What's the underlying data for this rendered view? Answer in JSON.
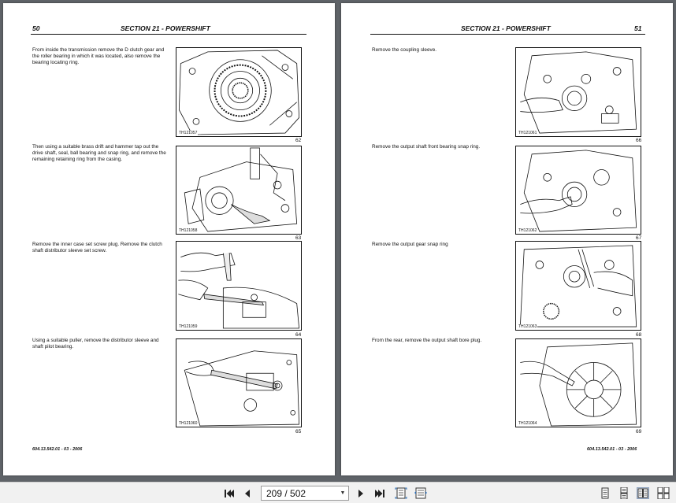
{
  "viewer": {
    "current_page": "209",
    "page_separator": "/",
    "total_pages": "502",
    "page_display": "209 / 502"
  },
  "left_page": {
    "page_number": "50",
    "section_title": "SECTION 21 -  POWERSHIFT",
    "footer": "604.13.542.01 - 03 - 2006",
    "steps": [
      {
        "text": "From inside the transmission remove the D clutch gear and the roller bearing in which it was located, also remove the bearing locating ring.",
        "code": "TH121057",
        "figure": "62"
      },
      {
        "text": "Then using a suitable brass drift and hammer tap out the drive shaft, seal, ball bearing and snap ring, and remove the remaining retaining ring from the casing.",
        "code": "TH121058",
        "figure": "63"
      },
      {
        "text": "Remove the inner case set screw plug. Remove the clutch shaft distributor sleeve set screw.",
        "code": "TH121059",
        "figure": "64"
      },
      {
        "text": "Using a suitable puller, remove the distributor sleeve and shaft pilot bearing.",
        "code": "TH121060",
        "figure": "65"
      }
    ]
  },
  "right_page": {
    "page_number": "51",
    "section_title": "SECTION 21 -  POWERSHIFT",
    "footer": "604.13.542.01 - 03 - 2006",
    "steps": [
      {
        "text": "Remove the coupling sleeve.",
        "code": "TH121061",
        "figure": "66"
      },
      {
        "text": "Remove the output shaft front bearing snap ring.",
        "code": "TH121062",
        "figure": "67"
      },
      {
        "text": "Remove the output gear snap ring",
        "code": "TH121063",
        "figure": "68"
      },
      {
        "text": "From the rear, remove the output shaft bore plug.",
        "code": "TH121064",
        "figure": "69"
      }
    ]
  },
  "toolbar": {
    "first_page_icon": "first-page-icon",
    "prev_page_icon": "prev-page-icon",
    "next_page_icon": "next-page-icon",
    "last_page_icon": "last-page-icon",
    "caret": "▼"
  }
}
